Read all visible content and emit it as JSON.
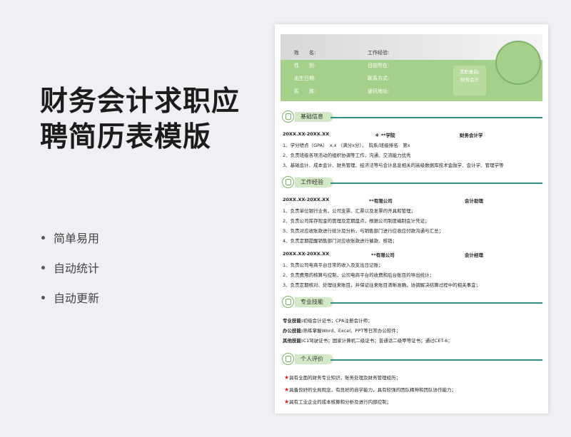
{
  "left": {
    "title_line1": "财务会计求职应",
    "title_line2": "聘简历表模版",
    "features": [
      "简单易用",
      "自动统计",
      "自动更新"
    ]
  },
  "resume": {
    "profile": {
      "name": "姓　　名:",
      "gender": "性　　别:",
      "birth": "出生日期:",
      "ethnic": "民　　族:",
      "experience": "工作经验:",
      "location": "目前所在:",
      "contact": "联系方式:",
      "address": "通讯地址:",
      "intent_line1": "求职意向:",
      "intent_line2": "财务会计"
    },
    "sections": {
      "basic": "基础信息",
      "work": "工作经验",
      "skills": "专业技能",
      "eval": "个人评价"
    },
    "basic": {
      "period": "20XX.XX-20XX.XX",
      "school": "＊ **学院",
      "major": "财务会计学",
      "lines": [
        "1、学分绩点（GPA）　x.x （满分x分），　院系/班级排名　第x",
        "2、负责班级各项活动的组织协调等工作，沟通、交流能力优秀",
        "3、基础会计、成本会计、财务管理、经济法等与会计息息相关的高级数据库技术金融学、会计学、管理学等"
      ]
    },
    "work": [
      {
        "period": "20XX.XX-20XX.XX",
        "company": "**有限公司",
        "role": "会计助理",
        "lines": [
          "1、负责单位银行业务，公司支票、汇票以及发票的开具和管理；",
          "2、负责公司库存现金的管理及定期盘点，根据公司制度编制会计凭证；",
          "3、负责对应收账款进行统计及分析，与销售部门进行应收应付款沟通与汇总；",
          "4、负责定期提醒销售部门对应收账款进行催款、核销；"
        ]
      },
      {
        "period": "20XX.XX-20XX.XX",
        "company": "**有限公司",
        "role": "会计经理",
        "lines": [
          "1、负责公司电商平台日常的收入及支出日记账；",
          "2、负责费用的核算与控制，公司电商平台的收费和后台账目的导出统计；",
          "3、负责定期核对、处理往来账目，并保证往来账目清晰准确，协调解决结算过程中的相关事宜；"
        ]
      }
    ],
    "skills": [
      {
        "label": "专业技能:",
        "text": "初级会计证书；CPA注册会计师；"
      },
      {
        "label": "办公技能:",
        "text": "熟练掌握Word、Excel、PPT等日常办公软件；"
      },
      {
        "label": "其他技能:",
        "text": "C1驾驶证书；国家计算机二级证书；普通话二级甲等证书；通过CET-6；"
      }
    ],
    "eval": [
      "具有全面的财务专业知识，账务处理及财务管理经历；",
      "具备良好的全局观念，有良好的自学能力，具有较强的团队精神和团队协作能力；",
      "具有工业企业的成本核算和分析及进行内部控制；"
    ],
    "star_glyph": "★"
  },
  "colors": {
    "accent_green": "#a5d08a",
    "line_teal": "#2f8f82",
    "star_red": "#e01e1e"
  }
}
